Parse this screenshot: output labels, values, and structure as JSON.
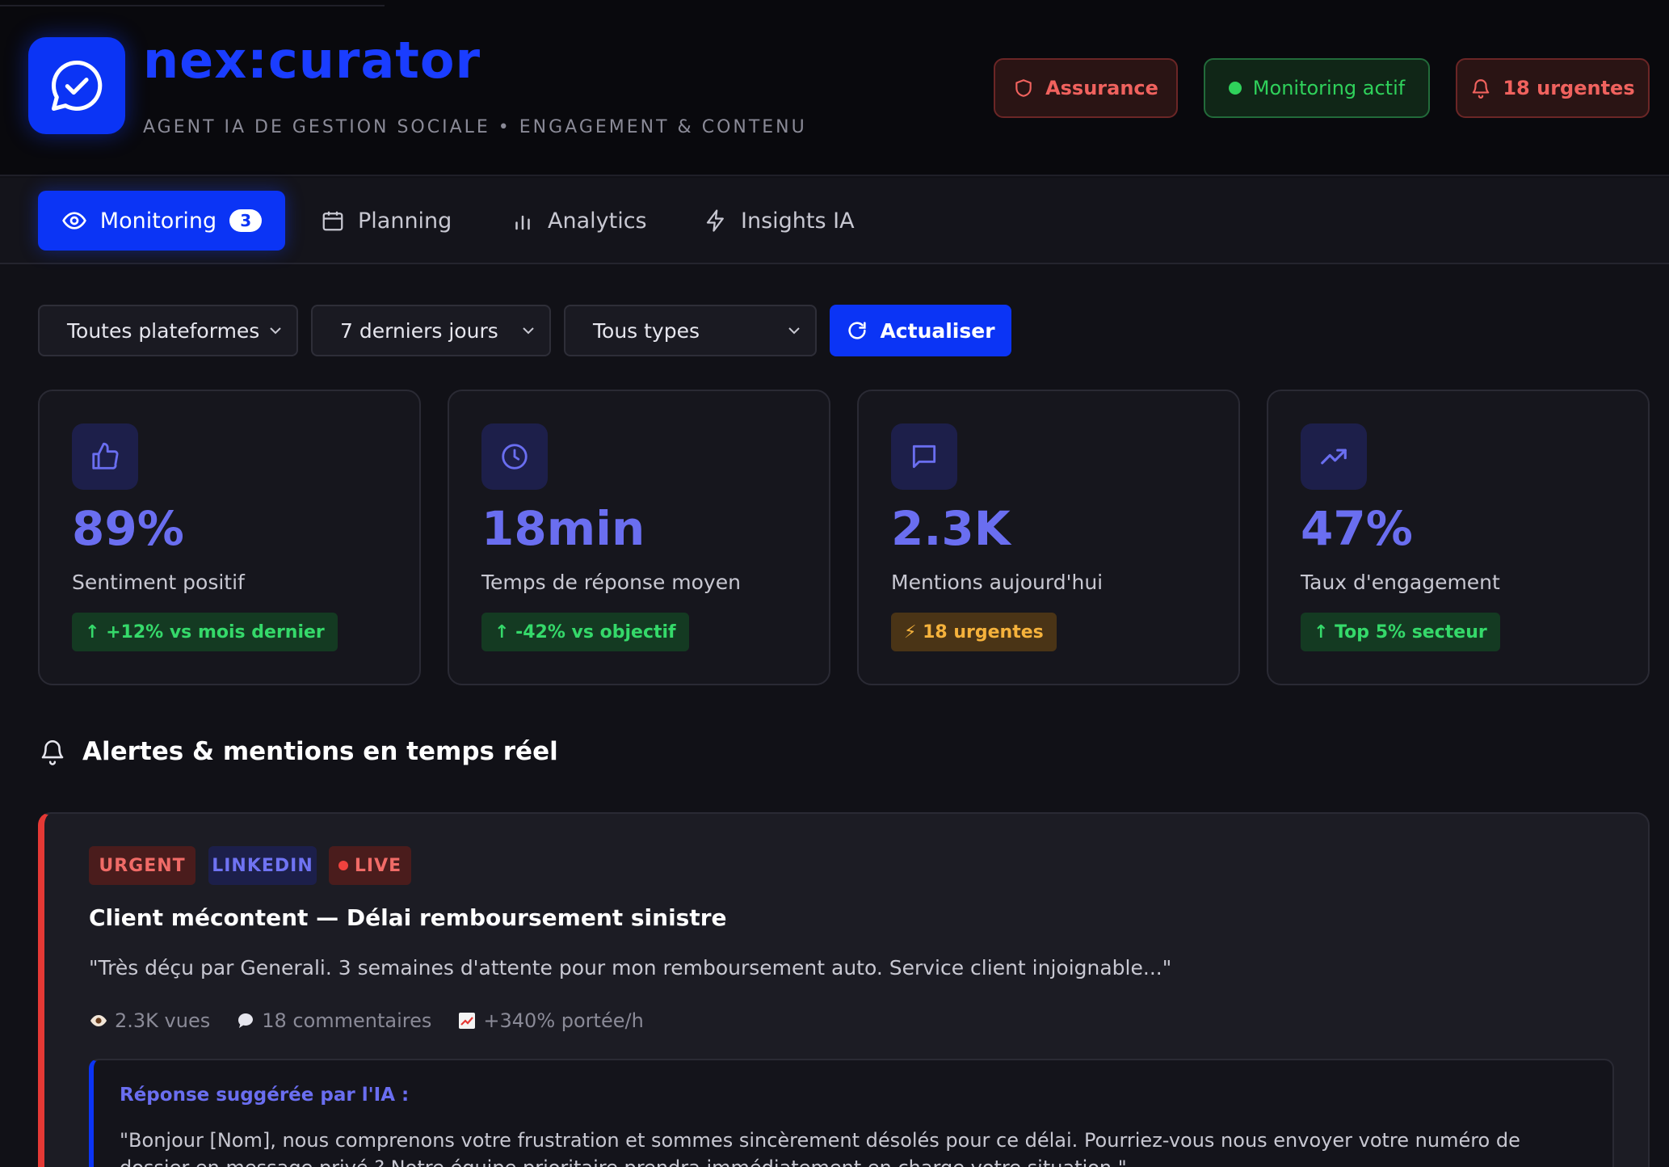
{
  "header": {
    "brand": "nex:curator",
    "tagline": "AGENT IA DE GESTION SOCIALE • ENGAGEMENT & CONTENU",
    "buttons": {
      "assurance": "Assurance",
      "monitoring": "Monitoring actif",
      "urgentes": "18 urgentes"
    }
  },
  "tabs": [
    {
      "label": "Monitoring",
      "badge": "3",
      "icon": "eye-icon",
      "active": true
    },
    {
      "label": "Planning",
      "icon": "calendar-icon"
    },
    {
      "label": "Analytics",
      "icon": "bar-chart-icon"
    },
    {
      "label": "Insights IA",
      "icon": "lightning-icon"
    }
  ],
  "filters": {
    "platform": "Toutes plateformes",
    "period": "7 derniers jours",
    "type": "Tous types",
    "refresh": "Actualiser"
  },
  "stats": [
    {
      "icon": "thumbs-up-icon",
      "value": "89%",
      "label": "Sentiment positif",
      "chip": "↑ +12% vs mois dernier",
      "chip_tone": "green"
    },
    {
      "icon": "clock-icon",
      "value": "18min",
      "label": "Temps de réponse moyen",
      "chip": "↑ -42% vs objectif",
      "chip_tone": "green"
    },
    {
      "icon": "message-icon",
      "value": "2.3K",
      "label": "Mentions aujourd'hui",
      "chip": "⚡ 18 urgentes",
      "chip_tone": "amber"
    },
    {
      "icon": "trending-up-icon",
      "value": "47%",
      "label": "Taux d'engagement",
      "chip": "↑ Top 5% secteur",
      "chip_tone": "green"
    }
  ],
  "section": {
    "title": "Alertes & mentions en temps réel"
  },
  "alert": {
    "tags": {
      "urgent": "URGENT",
      "platform": "LINKEDIN",
      "live": "LIVE"
    },
    "title": "Client mécontent — Délai remboursement sinistre",
    "quote": "\"Très déçu par Generali. 3 semaines d'attente pour mon remboursement auto. Service client injoignable...\"",
    "meta": {
      "views": "2.3K vues",
      "comments": "18 commentaires",
      "reach": "+340% portée/h"
    },
    "suggestion": {
      "label": "Réponse suggérée par l'IA :",
      "text": "\"Bonjour [Nom], nous comprenons votre frustration et sommes sincèrement désolés pour ce délai. Pourriez-vous nous envoyer votre numéro de dossier en message privé ? Notre équipe prioritaire prendra immédiatement en charge votre situation.\""
    }
  },
  "colors": {
    "accent": "#0b34f5",
    "stat_value": "#6a6ef0",
    "urgent": "#e53935",
    "success": "#2fd15b",
    "warning": "#f5b23c"
  }
}
